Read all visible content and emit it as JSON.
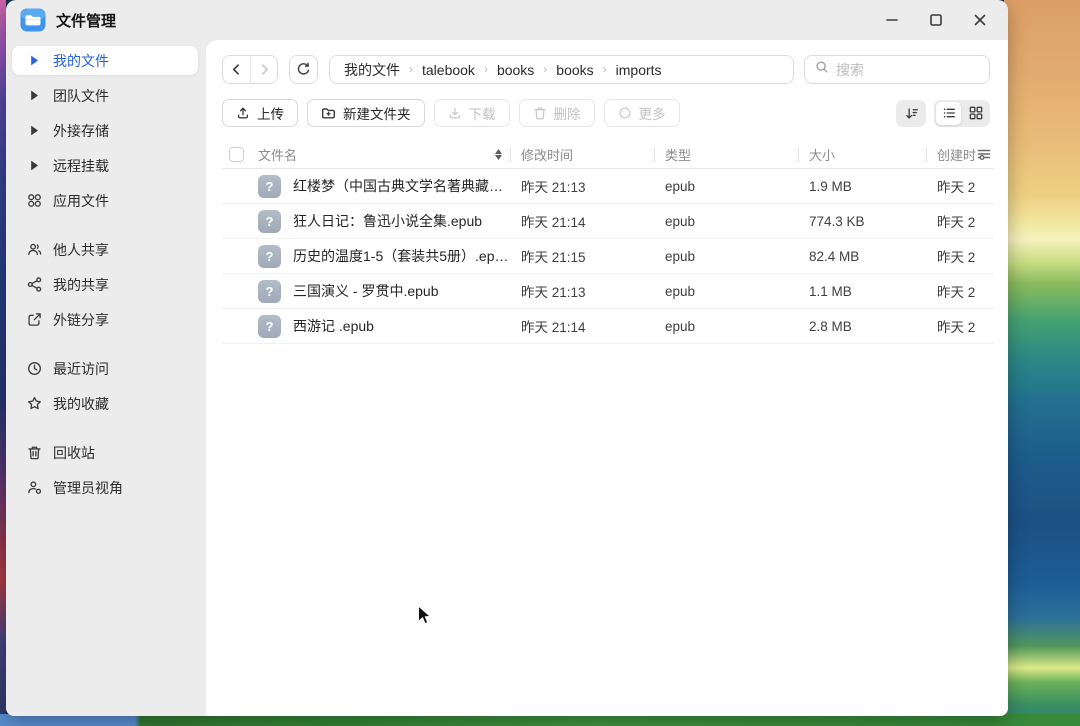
{
  "app": {
    "title": "文件管理"
  },
  "sidebar": {
    "items": [
      {
        "label": "我的文件",
        "selected": true
      },
      {
        "label": "团队文件"
      },
      {
        "label": "外接存储"
      },
      {
        "label": "远程挂载"
      },
      {
        "label": "应用文件"
      },
      {
        "label": "他人共享"
      },
      {
        "label": "我的共享"
      },
      {
        "label": "外链分享"
      },
      {
        "label": "最近访问"
      },
      {
        "label": "我的收藏"
      },
      {
        "label": "回收站"
      },
      {
        "label": "管理员视角"
      }
    ]
  },
  "breadcrumb": {
    "items": [
      "我的文件",
      "talebook",
      "books",
      "books",
      "imports"
    ],
    "separator": "›"
  },
  "search": {
    "placeholder": "搜索"
  },
  "toolbar": {
    "buttons": [
      {
        "label": "上传",
        "enabled": true
      },
      {
        "label": "新建文件夹",
        "enabled": true
      },
      {
        "label": "下载",
        "enabled": false
      },
      {
        "label": "删除",
        "enabled": false
      },
      {
        "label": "更多",
        "enabled": false
      }
    ]
  },
  "table": {
    "file_icon_glyph": "?",
    "headers": {
      "name": "文件名",
      "modified": "修改时间",
      "type": "类型",
      "size": "大小",
      "created": "创建时"
    },
    "rows": [
      {
        "name": "红楼梦（中国古典文学名著典藏…",
        "modified": "昨天 21:13",
        "type": "epub",
        "size": "1.9 MB",
        "created": "昨天 2"
      },
      {
        "name": "狂人日记：鲁迅小说全集.epub",
        "modified": "昨天 21:14",
        "type": "epub",
        "size": "774.3 KB",
        "created": "昨天 2"
      },
      {
        "name": "历史的温度1-5（套装共5册）.epub",
        "modified": "昨天 21:15",
        "type": "epub",
        "size": "82.4 MB",
        "created": "昨天 2"
      },
      {
        "name": "三国演义 - 罗贯中.epub",
        "modified": "昨天 21:13",
        "type": "epub",
        "size": "1.1 MB",
        "created": "昨天 2"
      },
      {
        "name": "西游记 .epub",
        "modified": "昨天 21:14",
        "type": "epub",
        "size": "2.8 MB",
        "created": "昨天 2"
      }
    ]
  },
  "icons": {
    "minimize": "—",
    "maximize": "□",
    "close": "✕",
    "sidebar": [
      "caret",
      "caret",
      "caret",
      "caret",
      "apps",
      "people",
      "share",
      "external-link",
      "clock",
      "star",
      "trash",
      "admin"
    ]
  },
  "colors": {
    "accent": "#2563d9",
    "titlebar_bg": "#edecec",
    "panel_bg": "#ffffff",
    "disabled_text": "#c2c2c2",
    "file_icon_bg": "#a6b0bf"
  }
}
